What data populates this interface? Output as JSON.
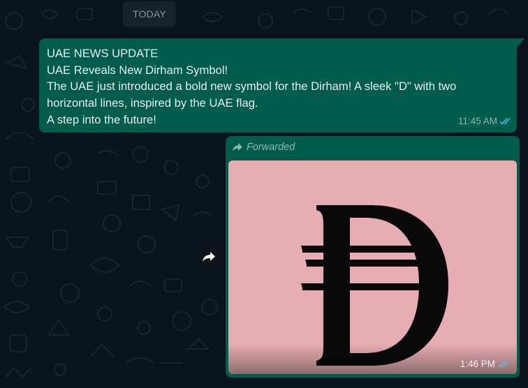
{
  "date_separator": "TODAY",
  "messages": [
    {
      "lines": [
        "UAE NEWS UPDATE",
        "UAE Reveals New Dirham Symbol!",
        "The UAE just introduced a bold new symbol for the Dirham! A sleek \"D\" with two",
        "horizontal lines, inspired by the UAE flag.",
        "A step into the future!"
      ],
      "time": "11:45 AM",
      "status": "read"
    },
    {
      "forwarded_label": "Forwarded",
      "media_icon": "dirham-symbol",
      "time": "1:46 PM",
      "status": "read"
    }
  ],
  "colors": {
    "chat_background": "#0b141a",
    "outgoing_bubble": "#005c4b",
    "read_ticks": "#53bdeb",
    "image_background": "#e8adb3"
  }
}
